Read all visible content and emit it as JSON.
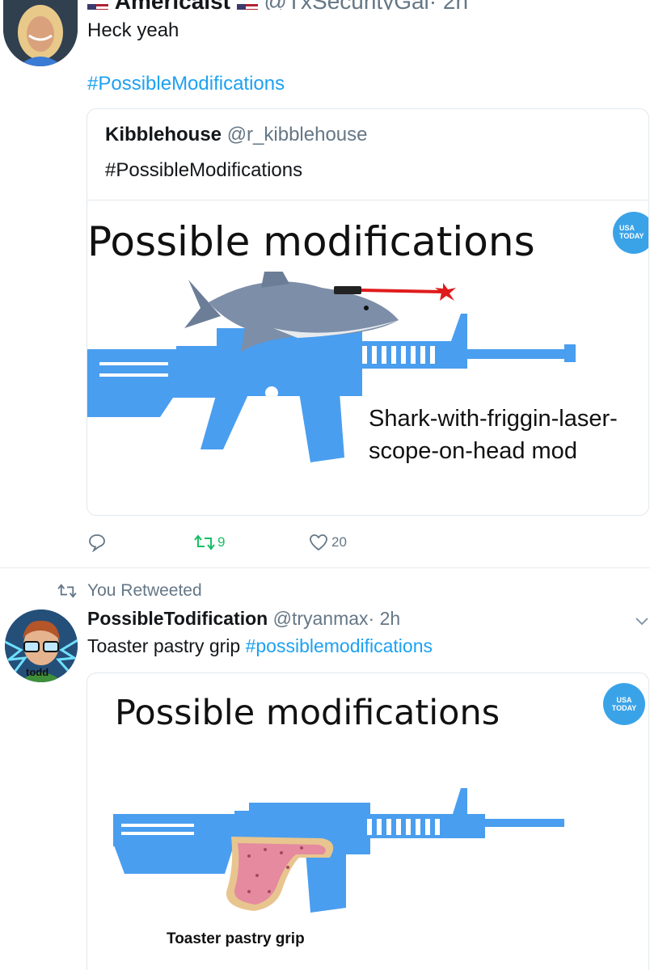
{
  "tweet1": {
    "author_name": "Americaist",
    "author_handle": "@TxSecurityGal",
    "time": "· 2h",
    "text": "Heck yeah",
    "hashtag": "#PossibleModifications",
    "quoted": {
      "name": "Kibblehouse",
      "handle": "@r_kibblehouse",
      "text": "#PossibleModifications",
      "image": {
        "title": "Possible modifications",
        "badge": "USA TODAY",
        "caption_line1": "Shark-with-friggin-laser-",
        "caption_line2": "scope-on-head mod"
      }
    },
    "actions": {
      "reply_count": "",
      "retweet_count": "9",
      "like_count": "20"
    }
  },
  "tweet2": {
    "retweeted_label": "You Retweeted",
    "author_name": "PossibleTodification",
    "author_handle": "@tryanmax",
    "time": "· 2h",
    "avatar_label": "todd",
    "text": "Toaster pastry grip",
    "hashtag": "#possiblemodifications",
    "image": {
      "title": "Possible modifications",
      "badge_line1": "USA",
      "badge_line2": "TODAY",
      "caption": "Toaster pastry grip"
    }
  },
  "colors": {
    "accent": "#1da1f2",
    "retweet_green": "#17bf63",
    "rifle_blue": "#4a9eef",
    "muted": "#657786"
  },
  "icons": [
    "reply-icon",
    "retweet-icon",
    "like-icon",
    "chevron-down-icon",
    "flag-icon"
  ]
}
